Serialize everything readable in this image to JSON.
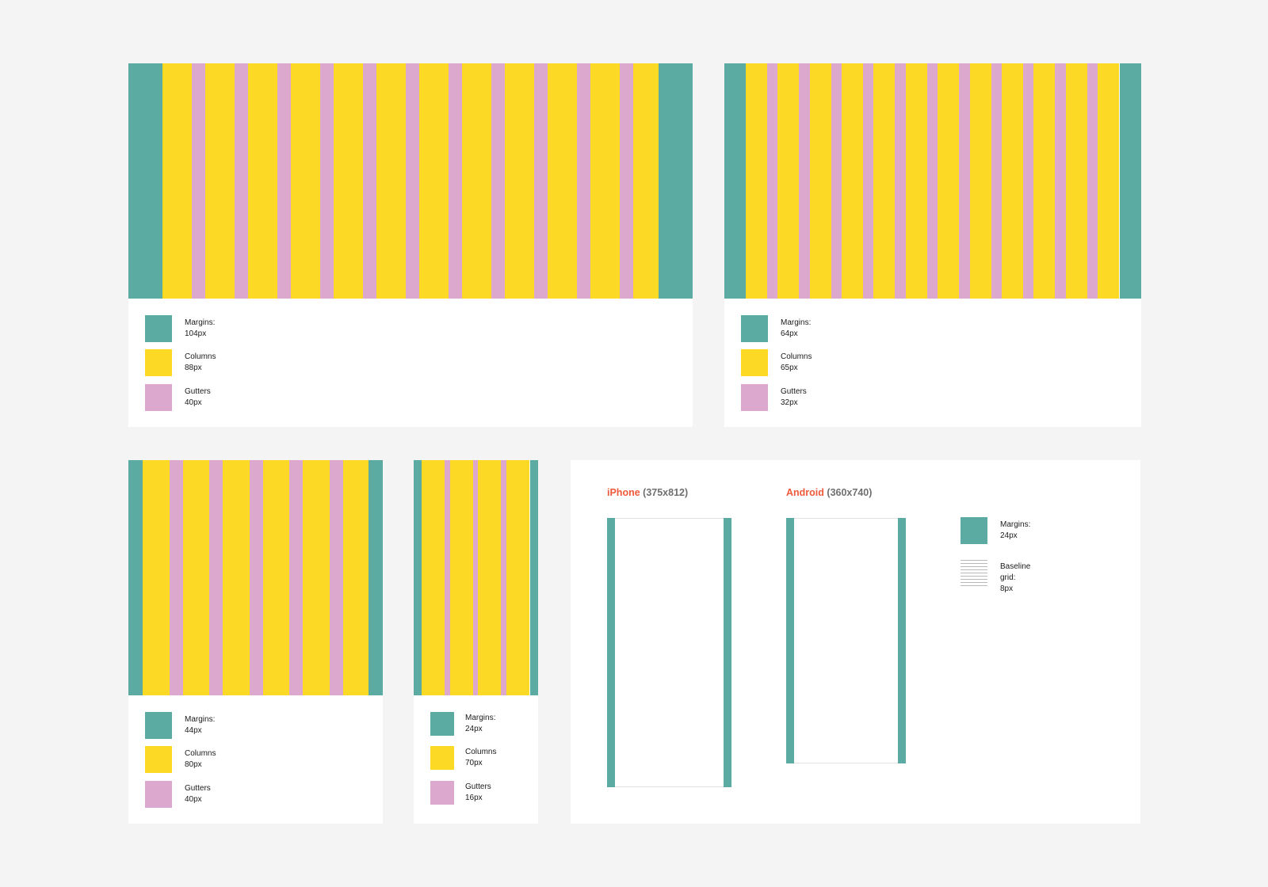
{
  "colors": {
    "margin": "#5baba3",
    "column": "#fcd924",
    "gutter": "#dca8ce",
    "background": "#f4f4f4",
    "card": "#ffffff",
    "brand_label": "#ef5a3c",
    "device_size": "#6f6f6f"
  },
  "grids": [
    {
      "columns_count": 12,
      "legend": {
        "margins": {
          "label": "Margins:",
          "value": "104px"
        },
        "columns": {
          "label": "Columns",
          "value": "88px"
        },
        "gutters": {
          "label": "Gutters",
          "value": "40px"
        }
      }
    },
    {
      "columns_count": 12,
      "legend": {
        "margins": {
          "label": "Margins:",
          "value": "64px"
        },
        "columns": {
          "label": "Columns",
          "value": "65px"
        },
        "gutters": {
          "label": "Gutters",
          "value": "32px"
        }
      }
    },
    {
      "columns_count": 6,
      "legend": {
        "margins": {
          "label": "Margins:",
          "value": "44px"
        },
        "columns": {
          "label": "Columns",
          "value": "80px"
        },
        "gutters": {
          "label": "Gutters",
          "value": "40px"
        }
      }
    },
    {
      "columns_count": 4,
      "legend": {
        "margins": {
          "label": "Margins:",
          "value": "24px"
        },
        "columns": {
          "label": "Columns",
          "value": "70px"
        },
        "gutters": {
          "label": "Gutters",
          "value": "16px"
        }
      }
    }
  ],
  "mobile": {
    "iphone": {
      "brand": "iPhone",
      "size": "(375x812)"
    },
    "android": {
      "brand": "Android",
      "size": "(360x740)"
    },
    "legend": {
      "margins": {
        "label": "Margins:",
        "value": "24px"
      },
      "baseline": {
        "label": "Baseline grid:",
        "value": "8px"
      }
    }
  }
}
